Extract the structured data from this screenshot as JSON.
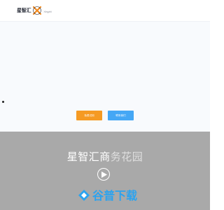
{
  "header": {
    "logo_text": "星智汇",
    "logo_sub": "Xingzhi"
  },
  "hero": {
    "primary_button": "免费试用",
    "secondary_button": "联系我们"
  },
  "video": {
    "title_main": "星智汇商",
    "title_light": "务花园"
  },
  "watermark": {
    "text": "谷普下载"
  },
  "colors": {
    "orange": "#f59a23",
    "blue": "#45a7f5",
    "video_bg": "#a9a9a9"
  },
  "icons": [
    "logo-mark-icon",
    "play-icon",
    "watermark-logo-icon"
  ]
}
